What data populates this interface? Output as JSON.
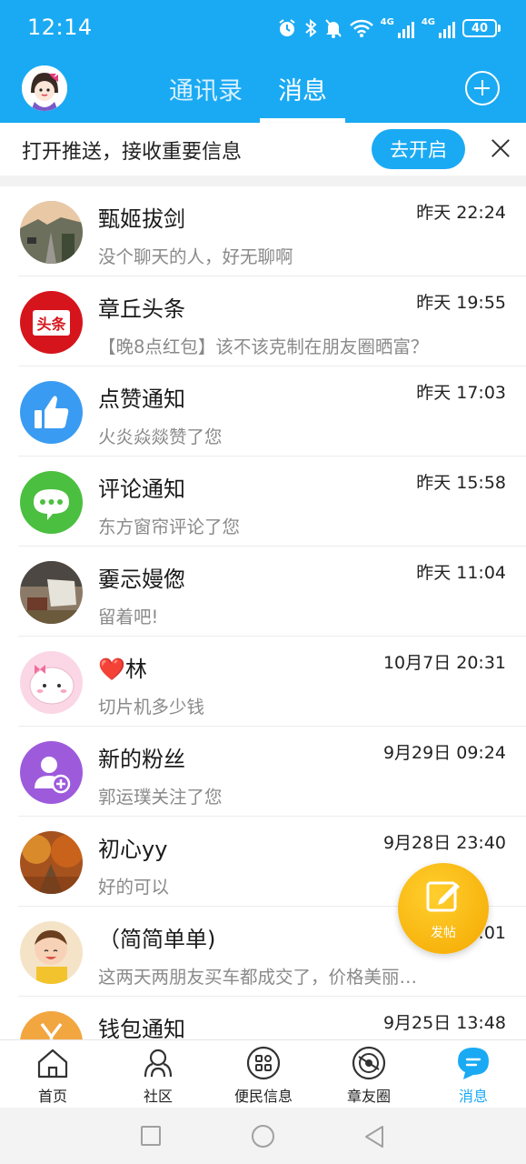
{
  "status_bar": {
    "time": "12:14",
    "net1_label": "4G",
    "net2_label": "4G",
    "battery": "40"
  },
  "header": {
    "tabs": [
      {
        "label": "通讯录",
        "active": false
      },
      {
        "label": "消息",
        "active": true
      }
    ]
  },
  "push_banner": {
    "text": "打开推送，接收重要信息",
    "button_label": "去开启"
  },
  "messages": [
    {
      "name": "甄姬拔剑",
      "time": "昨天 22:24",
      "preview": "没个聊天的人，好无聊啊",
      "avatar": "street-photo"
    },
    {
      "name": "章丘头条",
      "time": "昨天 19:55",
      "preview": "【晚8点红包】该不该克制在朋友圈晒富？",
      "avatar": "toutiao-logo",
      "avatar_text": "头条"
    },
    {
      "name": "点赞通知",
      "time": "昨天 17:03",
      "preview": "火炎焱燚赞了您",
      "avatar": "thumbs-up-icon"
    },
    {
      "name": "评论通知",
      "time": "昨天 15:58",
      "preview": "东方窗帘评论了您",
      "avatar": "chat-bubble-icon"
    },
    {
      "name": "嫑忈嫚偬",
      "time": "昨天 11:04",
      "preview": "留着吧!",
      "avatar": "tent-photo"
    },
    {
      "name": "❤️林",
      "time": "10月7日 20:31",
      "preview": "切片机多少钱",
      "avatar": "cartoon-girl"
    },
    {
      "name": "新的粉丝",
      "time": "9月29日 09:24",
      "preview": "郭运璞关注了您",
      "avatar": "add-user-icon"
    },
    {
      "name": "初心yy",
      "time": "9月28日 23:40",
      "preview": "好的可以",
      "avatar": "autumn-photo"
    },
    {
      "name": "（简简单单)",
      "time": "9月2…:01",
      "preview": "这两天两朋友买车都成交了，价格美丽…",
      "avatar": "baby-photo"
    },
    {
      "name": "钱包通知",
      "time": "9月25日 13:48",
      "preview": "",
      "avatar": "wallet-icon"
    }
  ],
  "fab": {
    "label": "发帖"
  },
  "bottom_nav": [
    {
      "label": "首页",
      "icon": "home-icon",
      "active": false
    },
    {
      "label": "社区",
      "icon": "community-icon",
      "active": false
    },
    {
      "label": "便民信息",
      "icon": "grid-icon",
      "active": false
    },
    {
      "label": "章友圈",
      "icon": "circle-icon",
      "active": false
    },
    {
      "label": "消息",
      "icon": "message-icon",
      "active": true
    }
  ],
  "colors": {
    "brand_blue": "#1aaaf3",
    "toutiao_red": "#d6141c",
    "thumbs_blue": "#3a9bf2",
    "chat_green": "#4bbf3f",
    "fan_purple": "#9d5bdc",
    "fab_yellow": "#f5b400"
  }
}
